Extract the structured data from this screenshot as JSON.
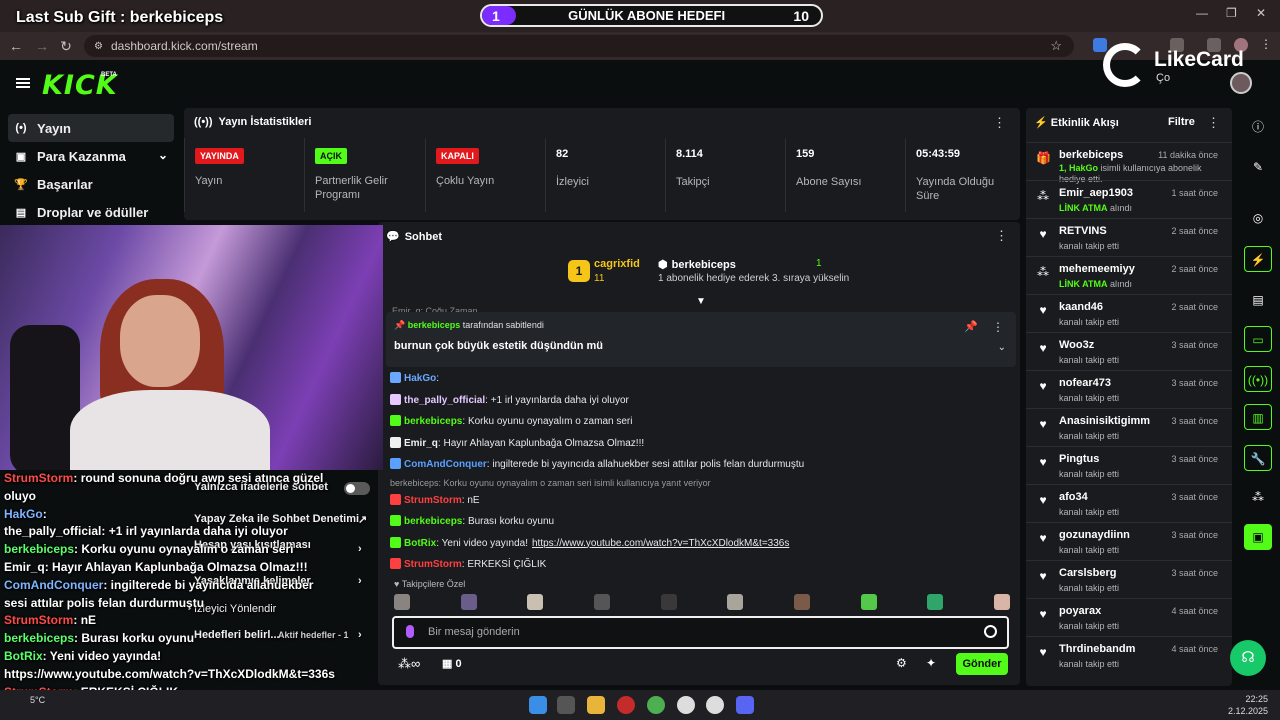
{
  "overlay": {
    "last_sub": "Last Sub Gift : berkebiceps",
    "goal": {
      "current": "1",
      "title": "GÜNLÜK ABONE HEDEFI",
      "total": "10",
      "progress": 0.1
    },
    "likecard_brand": "LikeCard",
    "likecard_sub": "Ço"
  },
  "browser": {
    "url": "dashboard.kick.com/stream"
  },
  "kick": {
    "logo": "KICK",
    "beta": "BETA"
  },
  "sidebar": {
    "items": [
      {
        "label": "Yayın",
        "icon": "(•)"
      },
      {
        "label": "Para Kazanma",
        "icon": "▣"
      },
      {
        "label": "Başarılar",
        "icon": "🏆"
      },
      {
        "label": "Droplar ve ödüller",
        "icon": "▤"
      }
    ]
  },
  "stats": {
    "title": "Yayın İstatistikleri",
    "cards": [
      {
        "badge": "YAYINDA",
        "label": "Yayın"
      },
      {
        "badge": "AÇIK",
        "label": "Partnerlik Gelir Programı"
      },
      {
        "badge": "KAPALI",
        "label": "Çoklu Yayın"
      },
      {
        "value": "82",
        "label": "İzleyici"
      },
      {
        "value": "8.114",
        "label": "Takipçi"
      },
      {
        "value": "159",
        "label": "Abone Sayısı"
      },
      {
        "value": "05:43:59",
        "label": "Yayında Olduğu Süre"
      }
    ]
  },
  "chat": {
    "title": "Sohbet",
    "gift": {
      "rank": "1",
      "gifter": "cagrixfid",
      "gifter_count": "11",
      "recipient": "berkebiceps",
      "recipient_count": "1",
      "message": "1 abonelik hediye ederek 3. sıraya yükselin"
    },
    "partial_line": "Emir_q: Çoğu Zaman",
    "pinned": {
      "by_user": "berkebiceps",
      "by_suffix": "tarafından sabitlendi",
      "text": "burnun çok büyük estetik düşündün mü"
    },
    "messages": [
      {
        "user": "HakGo",
        "text": "",
        "color": "#6aa8ff"
      },
      {
        "user": "the_pally_official",
        "text": "+1 irl yayınlarda daha iyi oluyor",
        "color": "#e7c8ff"
      },
      {
        "user": "berkebiceps",
        "text": "Korku oyunu oynayalım o zaman seri",
        "color": "#53fc18"
      },
      {
        "user": "Emir_q",
        "text": "Hayır Ahlayan Kaplunbağa Olmazsa Olmaz!!!",
        "color": "#f0f0f0"
      },
      {
        "user": "ComAndConquer",
        "text": "ingilterede bi yayıncıda allahuekber sesi attılar polis felan durdurmuştu",
        "color": "#5aa0ff"
      },
      {
        "reply": "berkebiceps: Korku oyunu oynayalım o zaman seri isimli kullanıcıya yanıt veriyor"
      },
      {
        "user": "StrumStorm",
        "text": "nE",
        "color": "#ff4040"
      },
      {
        "user": "berkebiceps",
        "text": "Burası korku oyunu",
        "color": "#53fc18"
      },
      {
        "user": "BotRix",
        "text": "Yeni video yayında!",
        "link": "https://www.youtube.com/watch?v=ThXcXDlodkM&t=336s",
        "color": "#53fc18"
      },
      {
        "user": "StrumStorm",
        "text": "ERKEKSİ ÇIĞLIK",
        "color": "#ff4040"
      }
    ],
    "emotes_label": "Takipçilere Özel",
    "input_placeholder": "Bir mesaj gönderin",
    "points": "0",
    "send_label": "Gönder"
  },
  "feed": {
    "title": "Etkinlik Akışı",
    "filter": "Filtre",
    "events": [
      {
        "icon": "gift",
        "user": "berkebiceps",
        "time": "11 dakika önce",
        "desc_highlight": "1, HakGo",
        "desc": " isimli kullanıcıya abonelik hediye etti."
      },
      {
        "icon": "reward",
        "user": "Emir_aep1903",
        "time": "1 saat önce",
        "desc_highlight": "LİNK ATMA",
        "desc": " alındı"
      },
      {
        "icon": "heart",
        "user": "RETVINS",
        "time": "2 saat önce",
        "desc": "kanalı takip etti"
      },
      {
        "icon": "reward",
        "user": "mehemeemiyy",
        "time": "2 saat önce",
        "desc_highlight": "LİNK ATMA",
        "desc": " alındı"
      },
      {
        "icon": "heart",
        "user": "kaand46",
        "time": "2 saat önce",
        "desc": "kanalı takip etti"
      },
      {
        "icon": "heart",
        "user": "Woo3z",
        "time": "3 saat önce",
        "desc": "kanalı takip etti"
      },
      {
        "icon": "heart",
        "user": "nofear473",
        "time": "3 saat önce",
        "desc": "kanalı takip etti"
      },
      {
        "icon": "heart",
        "user": "Anasinisiktigimm",
        "time": "3 saat önce",
        "desc": "kanalı takip etti"
      },
      {
        "icon": "heart",
        "user": "Pingtus",
        "time": "3 saat önce",
        "desc": "kanalı takip etti"
      },
      {
        "icon": "heart",
        "user": "afo34",
        "time": "3 saat önce",
        "desc": "kanalı takip etti"
      },
      {
        "icon": "heart",
        "user": "gozunaydiinn",
        "time": "3 saat önce",
        "desc": "kanalı takip etti"
      },
      {
        "icon": "heart",
        "user": "Carslsberg",
        "time": "3 saat önce",
        "desc": "kanalı takip etti"
      },
      {
        "icon": "heart",
        "user": "poyarax",
        "time": "4 saat önce",
        "desc": "kanalı takip etti"
      },
      {
        "icon": "heart",
        "user": "Thrdinebandm",
        "time": "4 saat önce",
        "desc": "kanalı takip etti"
      }
    ]
  },
  "overlay_chat": [
    {
      "user": "StrumStorm",
      "text": "round sonuna doğru awp sesi atınca güzel",
      "cls": "red"
    },
    {
      "cont": "oluyo"
    },
    {
      "user": "HakGo",
      "text": "",
      "cls": "blue"
    },
    {
      "user": "the_pally_official",
      "text": "+1 irl yayınlarda daha iyi oluyor",
      "cls": "n"
    },
    {
      "user": "berkebiceps",
      "text": "Korku oyunu oynayalım o zaman seri",
      "cls": "green"
    },
    {
      "user": "Emir_q",
      "text": "Hayır Ahlayan Kaplunbağa Olmazsa Olmaz!!!",
      "cls": "n"
    },
    {
      "user": "ComAndConquer",
      "text": "ingilterede bi yayıncıda allahuekber",
      "cls": "blue"
    },
    {
      "cont": "sesi attılar polis felan durdurmuştu"
    },
    {
      "user": "StrumStorm",
      "text": "nE",
      "cls": "red"
    },
    {
      "user": "berkebiceps",
      "text": "Burası korku oyunu",
      "cls": "green"
    },
    {
      "user": "BotRix",
      "text": "Yeni video yayında!",
      "cls": "green"
    },
    {
      "cont": "https://www.youtube.com/watch?v=ThXcXDlodkM&t=336s"
    },
    {
      "user": "StrumStorm",
      "text": "ERKEKSİ ÇIĞLIK",
      "cls": "red"
    }
  ],
  "ghost_menu": {
    "emote_only": "Yalnızca ifadelerle sohbet",
    "ai_moderation": "Yapay Zeka ile Sohbet Denetimi",
    "age_restriction": "Hesap yaşı kısıtlaması",
    "banned_words": "Yasaklanmış kelimeler",
    "viewer_redirect": "İzleyici Yönlendir",
    "goals": "Hedefleri belirl...",
    "active_goals": "Aktif hedefler - 1"
  },
  "taskbar": {
    "weather": "5°C",
    "time": "22:25",
    "date": "2.12.2025"
  }
}
